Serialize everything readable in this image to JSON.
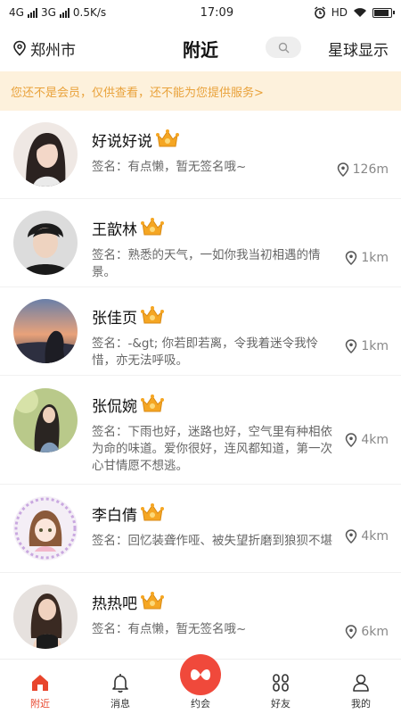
{
  "status": {
    "net1": "4G",
    "net2": "3G",
    "speed": "0.5K/s",
    "time": "17:09",
    "hd": "HD",
    "battery_level": 0.9
  },
  "header": {
    "location": "郑州市",
    "title": "附近",
    "planet_label": "星球显示"
  },
  "banner": {
    "text": "您还不是会员，仅供查看，还不能为您提供服务>"
  },
  "users": [
    {
      "name": "好说好说",
      "signature": "签名：有点懒，暂无签名哦~",
      "distance": "126m"
    },
    {
      "name": "王歆林",
      "signature": "签名：熟悉的天气，一如你我当初相遇的情景。",
      "distance": "1km"
    },
    {
      "name": "张佳页",
      "signature": "签名：-&gt; 你若即若离，令我着迷令我怜惜，亦无法呼吸。",
      "distance": "1km"
    },
    {
      "name": "张侃婉",
      "signature": "签名：下雨也好，迷路也好，空气里有种相依为命的味道。爱你很好，连风都知道，第一次心甘情愿不想逃。",
      "distance": "4km"
    },
    {
      "name": "李白倩",
      "signature": "签名：回忆装聋作哑、被失望折磨到狼狈不堪",
      "distance": "4km"
    },
    {
      "name": "热热吧",
      "signature": "签名：有点懒，暂无签名哦~",
      "distance": "6km"
    }
  ],
  "tabs": [
    {
      "label": "附近",
      "icon": "home-icon",
      "active": true
    },
    {
      "label": "消息",
      "icon": "bell-icon",
      "active": false
    },
    {
      "label": "约会",
      "icon": "date-icon",
      "active": false
    },
    {
      "label": "好友",
      "icon": "friends-icon",
      "active": false
    },
    {
      "label": "我的",
      "icon": "person-icon",
      "active": false
    }
  ],
  "colors": {
    "accent": "#e8452c",
    "banner_bg": "#fdf1dc",
    "banner_text": "#e9a23b"
  }
}
